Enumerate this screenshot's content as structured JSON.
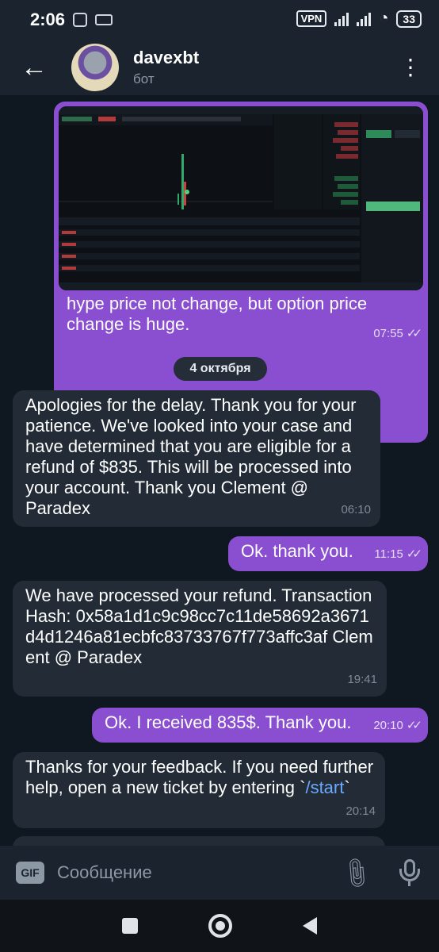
{
  "status_bar": {
    "time": "2:06",
    "vpn": "VPN",
    "battery": "33"
  },
  "header": {
    "back_icon": "arrow-left-icon",
    "name": "davexbt",
    "subtitle": "бот",
    "menu_icon": "more-vertical-icon"
  },
  "chat": {
    "date_separator": "4 октября",
    "messages": [
      {
        "direction": "outgoing",
        "has_image": true,
        "text": "hype price not change, but option price change is huge.",
        "time": "07:55",
        "read": true
      },
      {
        "direction": "incoming",
        "text": "Apologies for the delay. Thank you for your patience. We've looked into your case and have determined that you are eligible for a refund of $835. This will be processed into your account. Thank you Clement @ Paradex",
        "time": "06:10"
      },
      {
        "direction": "outgoing",
        "text": "Ok. thank you.",
        "time": "11:15",
        "read": true
      },
      {
        "direction": "incoming",
        "text": "We have processed your refund. Transaction Hash: 0x58a1d1c9c98cc7c11de58692a3671d4d1246a81ecbfc83733767f773affc3af Clement @ Paradex",
        "time": "19:41"
      },
      {
        "direction": "outgoing",
        "text": "Ok. I received 835$. Thank you.",
        "time": "20:10",
        "read": true
      },
      {
        "direction": "incoming",
        "text_before_link": "Thanks for your feedback. If you need further help, open a new ticket by entering `",
        "link": "/start",
        "text_after_link": "`",
        "time": "20:14"
      }
    ]
  },
  "composer": {
    "gif_label": "GIF",
    "placeholder": "Сообщение",
    "attach_icon": "paperclip-icon",
    "mic_icon": "microphone-icon"
  },
  "colors": {
    "outgoing_bubble": "#8a4fd0",
    "incoming_bubble": "#222b36",
    "background": "#0f1720",
    "link": "#6aa9ff"
  }
}
